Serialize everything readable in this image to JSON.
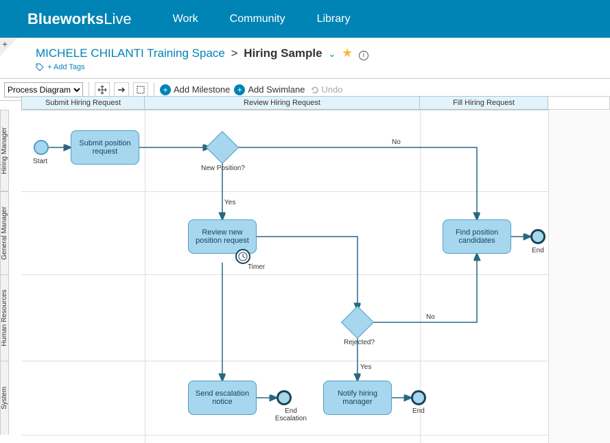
{
  "header": {
    "logo_main": "Blueworks",
    "logo_sub": "Live"
  },
  "nav": {
    "work": "Work",
    "community": "Community",
    "library": "Library"
  },
  "breadcrumb": {
    "parent": "MICHELE CHILANTI Training Space",
    "sep": ">",
    "current": "Hiring Sample",
    "add_tags": "+ Add Tags"
  },
  "toolbar": {
    "view": "Process Diagram",
    "add_milestone": "Add Milestone",
    "add_swimlane": "Add Swimlane",
    "undo": "Undo"
  },
  "milestones": {
    "m1": "Submit Hiring Request",
    "m2": "Review Hiring Request",
    "m3": "Fill Hiring Request"
  },
  "lanes": {
    "l1": "Hiring Manager",
    "l2": "General Manager",
    "l3": "Human Resources",
    "l4": "System"
  },
  "nodes": {
    "start_label": "Start",
    "submit": "Submit position request",
    "gw1": "New Position?",
    "yes1": "Yes",
    "no1": "No",
    "review": "Review new position request",
    "timer": "Timer",
    "gw2": "Rejected?",
    "yes2": "Yes",
    "no2": "No",
    "escalate": "Send escalation notice",
    "end_escalation_label": "End Escalation",
    "notify": "Notify hiring manager",
    "end2_label": "End",
    "find": "Find position candidates",
    "end3_label": "End"
  }
}
